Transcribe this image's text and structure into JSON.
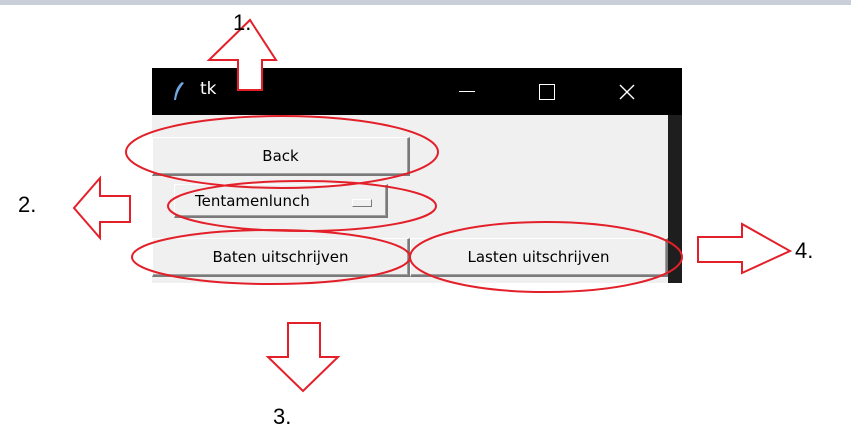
{
  "window": {
    "title": "tk",
    "controls": {
      "minimize": "minimize-icon",
      "maximize": "maximize-icon",
      "close": "close-icon"
    }
  },
  "buttons": {
    "back": "Back",
    "menu_selected": "Tentamenlunch",
    "baten": "Baten uitschrijven",
    "lasten": "Lasten uitschrijven"
  },
  "annotations": {
    "label_1": "1.",
    "label_2": "2.",
    "label_3": "3.",
    "label_4": "4."
  },
  "colors": {
    "annotation_red": "#e3202a",
    "window_bg": "#f0f0f0",
    "titlebar": "#000000"
  }
}
